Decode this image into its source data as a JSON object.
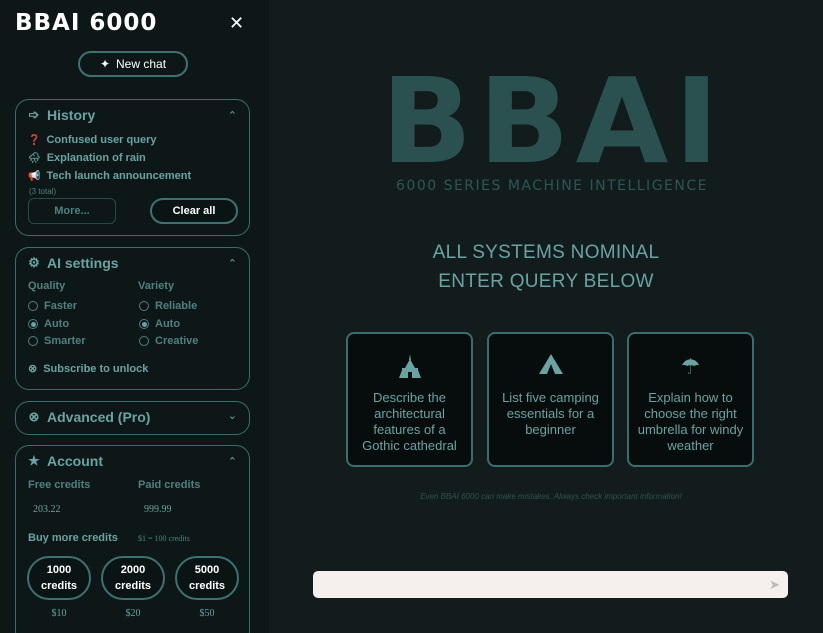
{
  "sidebar": {
    "brand": "BBAI 6000",
    "new_chat_label": "New chat",
    "history": {
      "title": "History",
      "items": [
        {
          "icon": "❓",
          "label": "Confused user query"
        },
        {
          "icon": "🌧",
          "label": "Explanation of rain"
        },
        {
          "icon": "📢",
          "label": "Tech launch announcement"
        }
      ],
      "total": "(3 total)",
      "more_label": "More...",
      "clear_label": "Clear all"
    },
    "ai_settings": {
      "title": "AI settings",
      "quality_label": "Quality",
      "variety_label": "Variety",
      "quality_options": [
        "Faster",
        "Auto",
        "Smarter"
      ],
      "variety_options": [
        "Reliable",
        "Auto",
        "Creative"
      ],
      "quality_selected": "Auto",
      "variety_selected": "Auto",
      "subscribe_label": "Subscribe to unlock"
    },
    "advanced": {
      "title": "Advanced (Pro)"
    },
    "account": {
      "title": "Account",
      "free_label": "Free credits",
      "paid_label": "Paid credits",
      "free_value": "203.22",
      "paid_value": "999.99",
      "buy_label": "Buy more credits",
      "rate": "$1 = 100 credits",
      "packs": [
        {
          "amount": "1000",
          "unit": "credits",
          "price": "$10"
        },
        {
          "amount": "2000",
          "unit": "credits",
          "price": "$20"
        },
        {
          "amount": "5000",
          "unit": "credits",
          "price": "$50"
        }
      ]
    }
  },
  "main": {
    "logo_text": "BBAI",
    "tagline": "6000 SERIES MACHINE INTELLIGENCE",
    "status_line1": "ALL SYSTEMS NOMINAL",
    "status_line2": "ENTER QUERY BELOW",
    "cards": [
      {
        "icon": "cathedral-icon",
        "text": "Describe the architectural features of a Gothic cathedral"
      },
      {
        "icon": "tent-icon",
        "text": "List five camping essentials for a beginner"
      },
      {
        "icon": "umbrella-icon",
        "text": "Explain how to choose the right umbrella for windy weather"
      }
    ],
    "disclaimer": "Even BBAI 6000 can make mistakes. Always check important information!",
    "input_placeholder": ""
  },
  "colors": {
    "sidebar_bg": "#0e1717",
    "main_bg": "#131c1c",
    "accent": "#6aa3a3",
    "logo": "#2a5050",
    "input_bg": "#f5efee"
  }
}
